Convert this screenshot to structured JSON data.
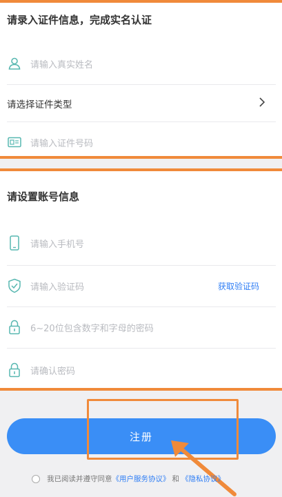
{
  "identity": {
    "title": "请录入证件信息，完成实名认证",
    "name_placeholder": "请输入真实姓名",
    "id_type_label": "请选择证件类型",
    "id_number_placeholder": "请输入证件号码"
  },
  "account": {
    "title": "请设置账号信息",
    "phone_placeholder": "请输入手机号",
    "code_placeholder": "请输入验证码",
    "get_code_label": "获取验证码",
    "password_placeholder": "6~20位包含数字和字母的密码",
    "confirm_placeholder": "请确认密码"
  },
  "register": {
    "button_label": "注册"
  },
  "agreement": {
    "prefix": "我已阅读并遵守同意",
    "user_agreement": "《用户服务协议》",
    "and": "和",
    "privacy_agreement": "《隐私协议》"
  },
  "colors": {
    "accent": "#3a8ef6",
    "annotation": "#f08a3a"
  }
}
